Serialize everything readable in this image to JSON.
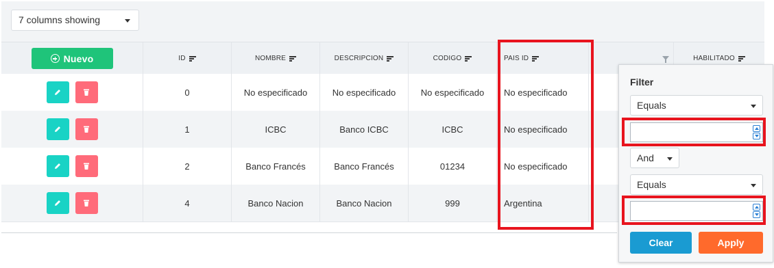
{
  "column_selector": {
    "label": "7 columns showing"
  },
  "header": {
    "nuevo_label": "Nuevo",
    "columns": [
      "ID",
      "NOMBRE",
      "DESCRIPCION",
      "CODIGO",
      "PAIS ID",
      "HABILITADO"
    ]
  },
  "rows": [
    {
      "id": "0",
      "nombre": "No especificado",
      "descripcion": "No especificado",
      "codigo": "No especificado",
      "pais_id": "No especificado"
    },
    {
      "id": "1",
      "nombre": "ICBC",
      "descripcion": "Banco ICBC",
      "codigo": "ICBC",
      "pais_id": "No especificado"
    },
    {
      "id": "2",
      "nombre": "Banco Francés",
      "descripcion": "Banco Francés",
      "codigo": "01234",
      "pais_id": "No especificado"
    },
    {
      "id": "4",
      "nombre": "Banco Nacion",
      "descripcion": "Banco Nacion",
      "codigo": "999",
      "pais_id": "Argentina"
    }
  ],
  "filter": {
    "title": "Filter",
    "condition1": "Equals",
    "value1": "",
    "join": "And",
    "condition2": "Equals",
    "value2": "",
    "clear_label": "Clear",
    "apply_label": "Apply"
  },
  "colors": {
    "nuevo_green": "#1fc47a",
    "edit_teal": "#19d3c5",
    "delete_red": "#ff6b7a",
    "clear_blue": "#1a9bd2",
    "apply_orange": "#ff6a2c",
    "highlight_red": "#e8141e"
  },
  "icons": [
    "add-circle-icon",
    "sort-icon",
    "filter-icon",
    "pencil-icon",
    "trash-icon",
    "chevron-down-icon",
    "spinner-up-icon",
    "spinner-down-icon"
  ]
}
